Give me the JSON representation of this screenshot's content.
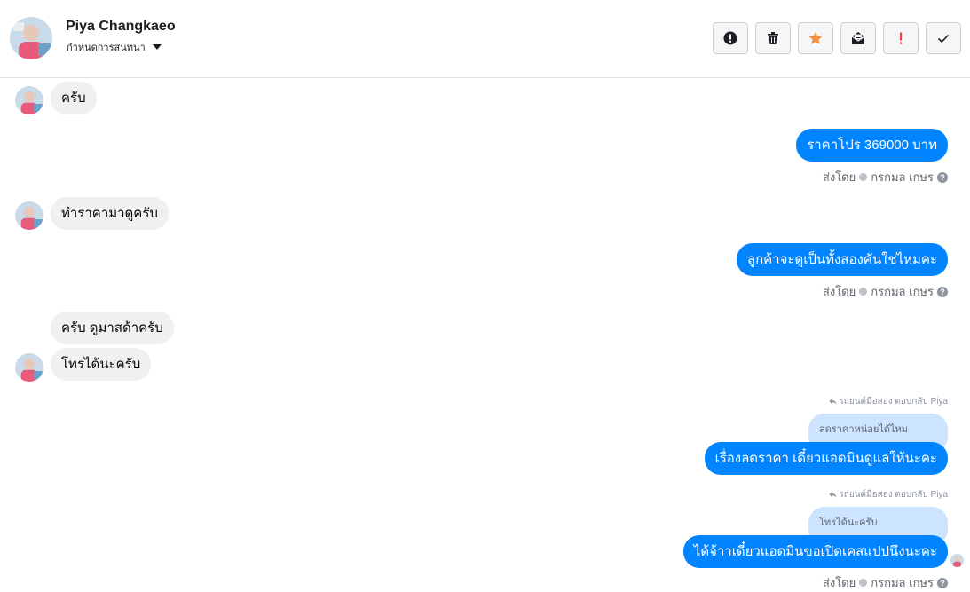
{
  "header": {
    "name": "Piya Changkaeo",
    "subtitle": "กำหนดการสนทนา",
    "tools": [
      {
        "icon": "alert-circle-icon",
        "name": "spam-button"
      },
      {
        "icon": "trash-icon",
        "name": "delete-button"
      },
      {
        "icon": "star-icon",
        "name": "star-button",
        "color": "#f7923b"
      },
      {
        "icon": "mark-unread-icon",
        "name": "mark-unread-button"
      },
      {
        "icon": "exclamation-icon",
        "name": "flag-button",
        "color": "#fa383e"
      },
      {
        "icon": "checkmark-icon",
        "name": "done-button"
      }
    ]
  },
  "messages": {
    "m1": "ครับ",
    "m2": "ราคาโปร 369000 บาท",
    "m2_sent_prefix": "ส่งโดย",
    "m2_sender": "กรกมล เกษร",
    "m3": "ทำราคามาดูครับ",
    "m4": "ลูกค้าจะดูเป็นทั้งสองคันใช่ไหมคะ",
    "m4_sent_prefix": "ส่งโดย",
    "m4_sender": "กรกมล เกษร",
    "m5": "ครับ ดูมาสด้าครับ",
    "m6": "โทรได้นะครับ",
    "r1_meta": "รถยนต์มือสอง ตอบกลับ Piya",
    "r1_quote": "ลดราคาหน่อยได้ไหม",
    "m7": "เรื่องลดราคา เดี๋ยวแอดมินดูแลให้นะคะ",
    "r2_meta": "รถยนต์มือสอง ตอบกลับ Piya",
    "r2_quote": "โทรได้นะครับ",
    "m8": "ได้จ้าาเดี๋ยวแอดมินขอเปิดเคสแปปนึงนะคะ",
    "m8_sent_prefix": "ส่งโดย",
    "m8_sender": "กรกมล เกษร"
  },
  "colors": {
    "outgoing_bubble": "#0084ff",
    "incoming_bubble": "#f0f0f0",
    "quoted_bubble": "#cce4ff"
  }
}
